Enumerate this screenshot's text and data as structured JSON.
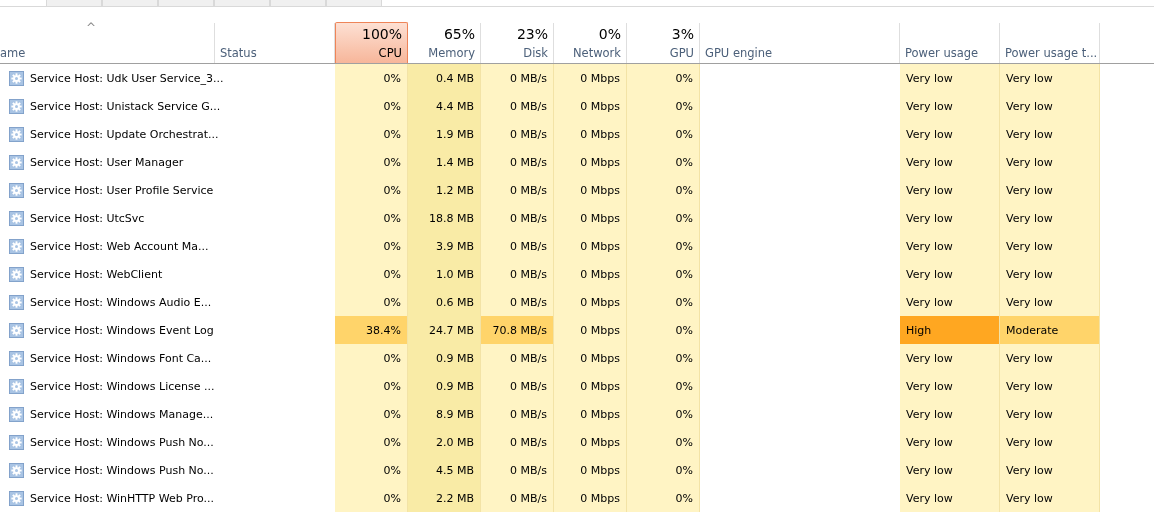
{
  "columns": [
    {
      "kind": "name",
      "label": "ame",
      "sort_caret": "^",
      "selected": false
    },
    {
      "kind": "text",
      "label": "Status",
      "selected": false
    },
    {
      "kind": "metric",
      "percent": "100%",
      "label": "CPU",
      "selected": true
    },
    {
      "kind": "metric",
      "percent": "65%",
      "label": "Memory",
      "selected": false
    },
    {
      "kind": "metric",
      "percent": "23%",
      "label": "Disk",
      "selected": false
    },
    {
      "kind": "metric",
      "percent": "0%",
      "label": "Network",
      "selected": false
    },
    {
      "kind": "metric",
      "percent": "3%",
      "label": "GPU",
      "selected": false
    },
    {
      "kind": "text",
      "label": "GPU engine",
      "selected": false
    },
    {
      "kind": "text",
      "label": "Power usage",
      "selected": false
    },
    {
      "kind": "text",
      "label": "Power usage t...",
      "selected": false
    }
  ],
  "rows": [
    {
      "name": "Service Host: Udk User Service_3...",
      "cpu": {
        "text": "0%",
        "color": "#fff4c4"
      },
      "memory": {
        "text": "0.4 MB",
        "color": "#f9eba6"
      },
      "disk": {
        "text": "0 MB/s",
        "color": "#fff4c4"
      },
      "network": {
        "text": "0 Mbps",
        "color": "#fff4c4"
      },
      "gpu": {
        "text": "0%",
        "color": "#fff4c4"
      },
      "power": {
        "text": "Very low",
        "color": "#fff4c4"
      },
      "power_trend": {
        "text": "Very low",
        "color": "#fff4c4"
      }
    },
    {
      "name": "Service Host: Unistack Service G...",
      "cpu": {
        "text": "0%",
        "color": "#fff4c4"
      },
      "memory": {
        "text": "4.4 MB",
        "color": "#f9eba6"
      },
      "disk": {
        "text": "0 MB/s",
        "color": "#fff4c4"
      },
      "network": {
        "text": "0 Mbps",
        "color": "#fff4c4"
      },
      "gpu": {
        "text": "0%",
        "color": "#fff4c4"
      },
      "power": {
        "text": "Very low",
        "color": "#fff4c4"
      },
      "power_trend": {
        "text": "Very low",
        "color": "#fff4c4"
      }
    },
    {
      "name": "Service Host: Update Orchestrat...",
      "cpu": {
        "text": "0%",
        "color": "#fff4c4"
      },
      "memory": {
        "text": "1.9 MB",
        "color": "#f9eba6"
      },
      "disk": {
        "text": "0 MB/s",
        "color": "#fff4c4"
      },
      "network": {
        "text": "0 Mbps",
        "color": "#fff4c4"
      },
      "gpu": {
        "text": "0%",
        "color": "#fff4c4"
      },
      "power": {
        "text": "Very low",
        "color": "#fff4c4"
      },
      "power_trend": {
        "text": "Very low",
        "color": "#fff4c4"
      }
    },
    {
      "name": "Service Host: User Manager",
      "cpu": {
        "text": "0%",
        "color": "#fff4c4"
      },
      "memory": {
        "text": "1.4 MB",
        "color": "#f9eba6"
      },
      "disk": {
        "text": "0 MB/s",
        "color": "#fff4c4"
      },
      "network": {
        "text": "0 Mbps",
        "color": "#fff4c4"
      },
      "gpu": {
        "text": "0%",
        "color": "#fff4c4"
      },
      "power": {
        "text": "Very low",
        "color": "#fff4c4"
      },
      "power_trend": {
        "text": "Very low",
        "color": "#fff4c4"
      }
    },
    {
      "name": "Service Host: User Profile Service",
      "cpu": {
        "text": "0%",
        "color": "#fff4c4"
      },
      "memory": {
        "text": "1.2 MB",
        "color": "#f9eba6"
      },
      "disk": {
        "text": "0 MB/s",
        "color": "#fff4c4"
      },
      "network": {
        "text": "0 Mbps",
        "color": "#fff4c4"
      },
      "gpu": {
        "text": "0%",
        "color": "#fff4c4"
      },
      "power": {
        "text": "Very low",
        "color": "#fff4c4"
      },
      "power_trend": {
        "text": "Very low",
        "color": "#fff4c4"
      }
    },
    {
      "name": "Service Host: UtcSvc",
      "cpu": {
        "text": "0%",
        "color": "#fff4c4"
      },
      "memory": {
        "text": "18.8 MB",
        "color": "#f9eba6"
      },
      "disk": {
        "text": "0 MB/s",
        "color": "#fff4c4"
      },
      "network": {
        "text": "0 Mbps",
        "color": "#fff4c4"
      },
      "gpu": {
        "text": "0%",
        "color": "#fff4c4"
      },
      "power": {
        "text": "Very low",
        "color": "#fff4c4"
      },
      "power_trend": {
        "text": "Very low",
        "color": "#fff4c4"
      }
    },
    {
      "name": "Service Host: Web Account Ma...",
      "cpu": {
        "text": "0%",
        "color": "#fff4c4"
      },
      "memory": {
        "text": "3.9 MB",
        "color": "#f9eba6"
      },
      "disk": {
        "text": "0 MB/s",
        "color": "#fff4c4"
      },
      "network": {
        "text": "0 Mbps",
        "color": "#fff4c4"
      },
      "gpu": {
        "text": "0%",
        "color": "#fff4c4"
      },
      "power": {
        "text": "Very low",
        "color": "#fff4c4"
      },
      "power_trend": {
        "text": "Very low",
        "color": "#fff4c4"
      }
    },
    {
      "name": "Service Host: WebClient",
      "cpu": {
        "text": "0%",
        "color": "#fff4c4"
      },
      "memory": {
        "text": "1.0 MB",
        "color": "#f9eba6"
      },
      "disk": {
        "text": "0 MB/s",
        "color": "#fff4c4"
      },
      "network": {
        "text": "0 Mbps",
        "color": "#fff4c4"
      },
      "gpu": {
        "text": "0%",
        "color": "#fff4c4"
      },
      "power": {
        "text": "Very low",
        "color": "#fff4c4"
      },
      "power_trend": {
        "text": "Very low",
        "color": "#fff4c4"
      }
    },
    {
      "name": "Service Host: Windows Audio E...",
      "cpu": {
        "text": "0%",
        "color": "#fff4c4"
      },
      "memory": {
        "text": "0.6 MB",
        "color": "#f9eba6"
      },
      "disk": {
        "text": "0 MB/s",
        "color": "#fff4c4"
      },
      "network": {
        "text": "0 Mbps",
        "color": "#fff4c4"
      },
      "gpu": {
        "text": "0%",
        "color": "#fff4c4"
      },
      "power": {
        "text": "Very low",
        "color": "#fff4c4"
      },
      "power_trend": {
        "text": "Very low",
        "color": "#fff4c4"
      }
    },
    {
      "name": "Service Host: Windows Event Log",
      "cpu": {
        "text": "38.4%",
        "color": "#ffd46a"
      },
      "memory": {
        "text": "24.7 MB",
        "color": "#f9eba6"
      },
      "disk": {
        "text": "70.8 MB/s",
        "color": "#ffd46a"
      },
      "network": {
        "text": "0 Mbps",
        "color": "#fff4c4"
      },
      "gpu": {
        "text": "0%",
        "color": "#fff4c4"
      },
      "power": {
        "text": "High",
        "color": "#ffa721"
      },
      "power_trend": {
        "text": "Moderate",
        "color": "#ffd46a"
      }
    },
    {
      "name": "Service Host: Windows Font Ca...",
      "cpu": {
        "text": "0%",
        "color": "#fff4c4"
      },
      "memory": {
        "text": "0.9 MB",
        "color": "#f9eba6"
      },
      "disk": {
        "text": "0 MB/s",
        "color": "#fff4c4"
      },
      "network": {
        "text": "0 Mbps",
        "color": "#fff4c4"
      },
      "gpu": {
        "text": "0%",
        "color": "#fff4c4"
      },
      "power": {
        "text": "Very low",
        "color": "#fff4c4"
      },
      "power_trend": {
        "text": "Very low",
        "color": "#fff4c4"
      }
    },
    {
      "name": "Service Host: Windows License ...",
      "cpu": {
        "text": "0%",
        "color": "#fff4c4"
      },
      "memory": {
        "text": "0.9 MB",
        "color": "#f9eba6"
      },
      "disk": {
        "text": "0 MB/s",
        "color": "#fff4c4"
      },
      "network": {
        "text": "0 Mbps",
        "color": "#fff4c4"
      },
      "gpu": {
        "text": "0%",
        "color": "#fff4c4"
      },
      "power": {
        "text": "Very low",
        "color": "#fff4c4"
      },
      "power_trend": {
        "text": "Very low",
        "color": "#fff4c4"
      }
    },
    {
      "name": "Service Host: Windows Manage...",
      "cpu": {
        "text": "0%",
        "color": "#fff4c4"
      },
      "memory": {
        "text": "8.9 MB",
        "color": "#f9eba6"
      },
      "disk": {
        "text": "0 MB/s",
        "color": "#fff4c4"
      },
      "network": {
        "text": "0 Mbps",
        "color": "#fff4c4"
      },
      "gpu": {
        "text": "0%",
        "color": "#fff4c4"
      },
      "power": {
        "text": "Very low",
        "color": "#fff4c4"
      },
      "power_trend": {
        "text": "Very low",
        "color": "#fff4c4"
      }
    },
    {
      "name": "Service Host: Windows Push No...",
      "cpu": {
        "text": "0%",
        "color": "#fff4c4"
      },
      "memory": {
        "text": "2.0 MB",
        "color": "#f9eba6"
      },
      "disk": {
        "text": "0 MB/s",
        "color": "#fff4c4"
      },
      "network": {
        "text": "0 Mbps",
        "color": "#fff4c4"
      },
      "gpu": {
        "text": "0%",
        "color": "#fff4c4"
      },
      "power": {
        "text": "Very low",
        "color": "#fff4c4"
      },
      "power_trend": {
        "text": "Very low",
        "color": "#fff4c4"
      }
    },
    {
      "name": "Service Host: Windows Push No...",
      "cpu": {
        "text": "0%",
        "color": "#fff4c4"
      },
      "memory": {
        "text": "4.5 MB",
        "color": "#f9eba6"
      },
      "disk": {
        "text": "0 MB/s",
        "color": "#fff4c4"
      },
      "network": {
        "text": "0 Mbps",
        "color": "#fff4c4"
      },
      "gpu": {
        "text": "0%",
        "color": "#fff4c4"
      },
      "power": {
        "text": "Very low",
        "color": "#fff4c4"
      },
      "power_trend": {
        "text": "Very low",
        "color": "#fff4c4"
      }
    },
    {
      "name": "Service Host: WinHTTP Web Pro...",
      "cpu": {
        "text": "0%",
        "color": "#fff4c4"
      },
      "memory": {
        "text": "2.2 MB",
        "color": "#f9eba6"
      },
      "disk": {
        "text": "0 MB/s",
        "color": "#fff4c4"
      },
      "network": {
        "text": "0 Mbps",
        "color": "#fff4c4"
      },
      "gpu": {
        "text": "0%",
        "color": "#fff4c4"
      },
      "power": {
        "text": "Very low",
        "color": "#fff4c4"
      },
      "power_trend": {
        "text": "Very low",
        "color": "#fff4c4"
      }
    }
  ]
}
